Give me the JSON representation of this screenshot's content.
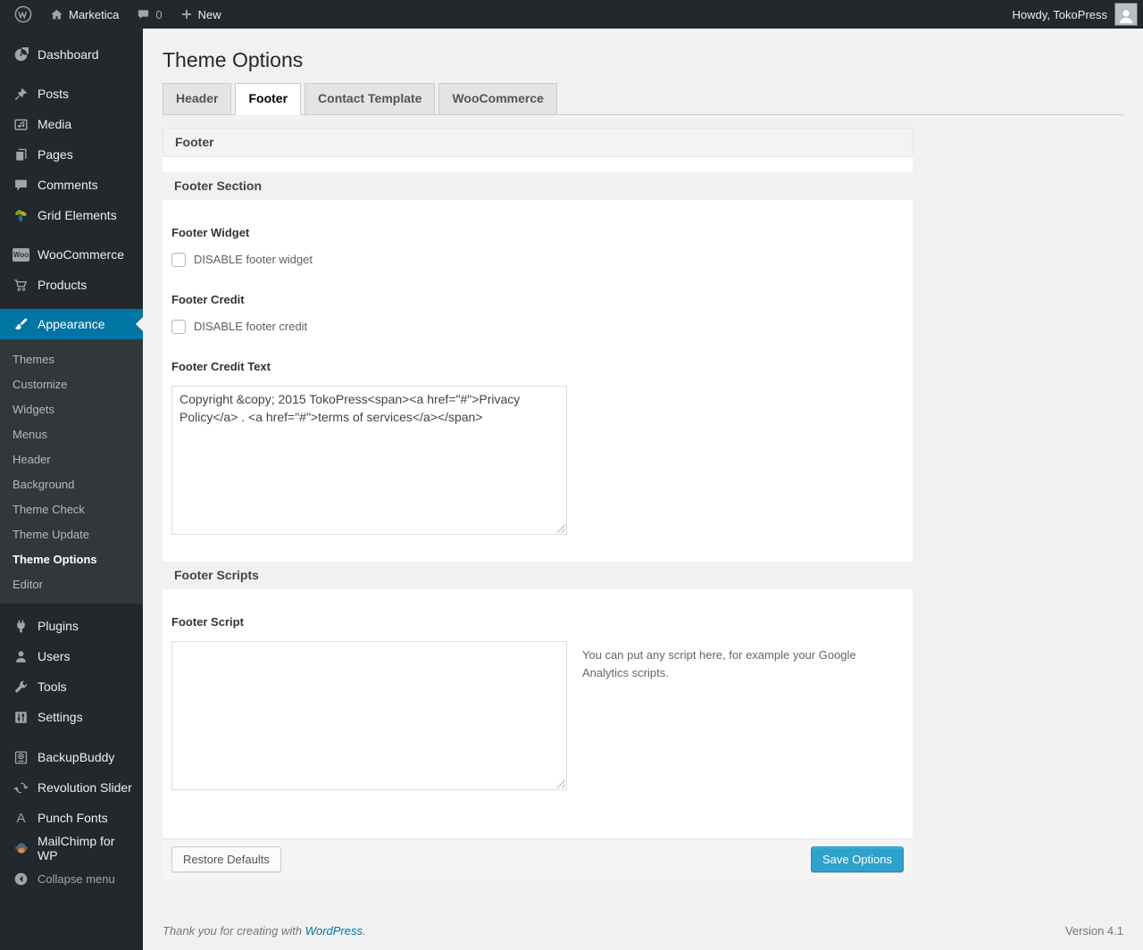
{
  "admin_bar": {
    "site_name": "Marketica",
    "comment_count": "0",
    "new_label": "New",
    "howdy_text": "Howdy, TokoPress"
  },
  "sidebar": {
    "items": {
      "dashboard": "Dashboard",
      "posts": "Posts",
      "media": "Media",
      "pages": "Pages",
      "comments": "Comments",
      "grid_elements": "Grid Elements",
      "woocommerce": "WooCommerce",
      "products": "Products",
      "appearance": "Appearance",
      "plugins": "Plugins",
      "users": "Users",
      "tools": "Tools",
      "settings": "Settings",
      "backupbuddy": "BackupBuddy",
      "revolution_slider": "Revolution Slider",
      "punch_fonts": "Punch Fonts",
      "mailchimp": "MailChimp for WP",
      "collapse": "Collapse menu"
    },
    "woo_badge_text": "Woo",
    "punch_fonts_glyph": "A",
    "appearance_submenu": [
      "Themes",
      "Customize",
      "Widgets",
      "Menus",
      "Header",
      "Background",
      "Theme Check",
      "Theme Update",
      "Theme Options",
      "Editor"
    ],
    "active_item": "Appearance",
    "active_submenu_item": "Theme Options"
  },
  "main": {
    "title": "Theme Options",
    "tabs": [
      "Header",
      "Footer",
      "Contact Template",
      "WooCommerce"
    ],
    "active_tab": "Footer"
  },
  "panel": {
    "title": "Footer",
    "section1": {
      "heading": "Footer Section",
      "footer_widget_label": "Footer Widget",
      "footer_widget_checkbox_label": "DISABLE footer widget",
      "footer_widget_checked": false,
      "footer_credit_label": "Footer Credit",
      "footer_credit_checkbox_label": "DISABLE footer credit",
      "footer_credit_checked": false,
      "footer_credit_text_label": "Footer Credit Text",
      "footer_credit_text_value": "Copyright &copy; 2015 TokoPress<span><a href=\"#\">Privacy Policy</a> . <a href=\"#\">terms of services</a></span>"
    },
    "section2": {
      "heading": "Footer Scripts",
      "footer_script_label": "Footer Script",
      "footer_script_value": "",
      "footer_script_help": "You can put any script here, for example your Google Analytics scripts."
    },
    "buttons": {
      "restore": "Restore Defaults",
      "save": "Save Options"
    }
  },
  "footer": {
    "thanks_text": "Thank you for creating with",
    "wordpress_link": "WordPress",
    "suffix": ".",
    "version": "Version 4.1"
  },
  "icon_names": [
    "wordpress-logo-icon",
    "home-icon",
    "comment-icon",
    "plus-icon",
    "avatar",
    "dashboard-icon",
    "pin-icon",
    "media-icon",
    "pages-icon",
    "comments-icon",
    "grid-elements-icon",
    "woo-icon",
    "cart-icon",
    "brush-icon",
    "plug-icon",
    "user-icon",
    "wrench-icon",
    "settings-icon",
    "backup-drive-icon",
    "cycle-arrows-icon",
    "letter-a-icon",
    "mailchimp-monkey-icon",
    "collapse-arrow-icon"
  ],
  "colors": {
    "admin_bar_bg": "#23282d",
    "menu_bg": "#23282d",
    "submenu_bg": "#32373c",
    "active_highlight": "#0074a2",
    "primary_button": "#2ea2cc",
    "primary_button_border": "#1e8cbe",
    "link_blue": "#0074a2",
    "page_bg": "#f1f1f1",
    "panel_bg": "#ffffff"
  }
}
